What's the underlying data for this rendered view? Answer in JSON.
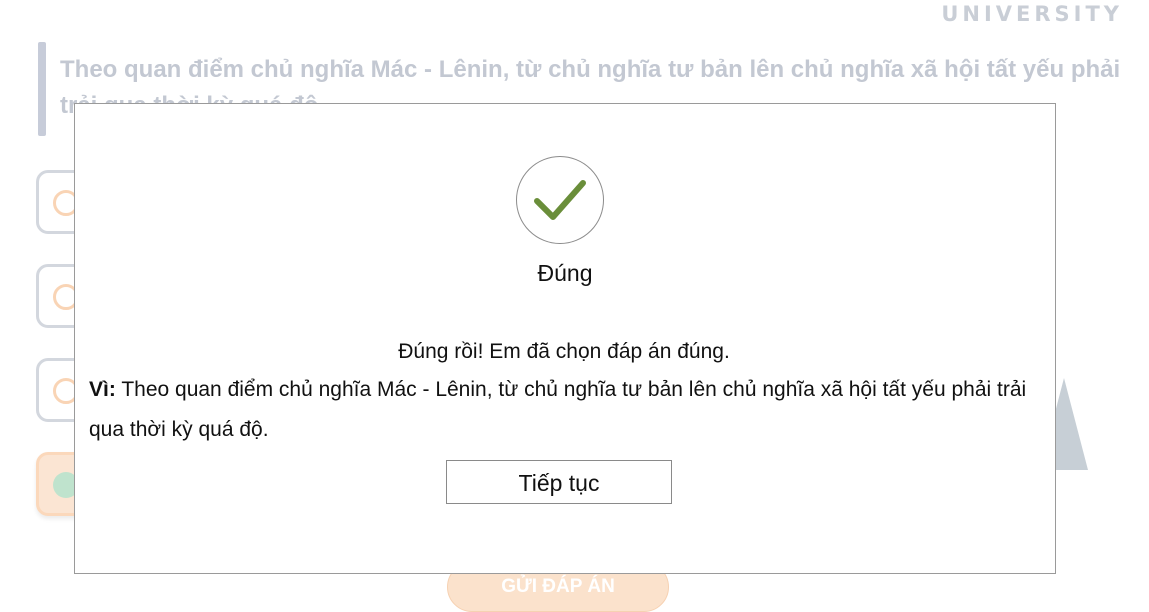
{
  "brand": {
    "name": "UNIVERSITY"
  },
  "question": {
    "text": "Theo quan điểm chủ nghĩa Mác - Lênin, từ chủ nghĩa tư bản lên chủ nghĩa xã hội tất yếu phải trải qua thời kỳ quá độ."
  },
  "options": [
    {
      "selected": false
    },
    {
      "selected": false
    },
    {
      "selected": false
    },
    {
      "selected": true
    }
  ],
  "submit": {
    "label": "GỬI ĐÁP ÁN"
  },
  "modal": {
    "icon": "check-icon",
    "title": "Đúng",
    "message": "Đúng rồi! Em đã chọn đáp án đúng.",
    "reason_label": "Vì:",
    "reason_text": "Theo quan điểm chủ nghĩa Mác - Lênin, từ chủ nghĩa tư bản lên chủ nghĩa xã hội tất yếu phải trải qua thời kỳ quá độ.",
    "continue_label": "Tiếp tục"
  },
  "colors": {
    "check": "#6a8e3a",
    "accent": "#f7a35c",
    "muted": "#c3c8d2"
  }
}
